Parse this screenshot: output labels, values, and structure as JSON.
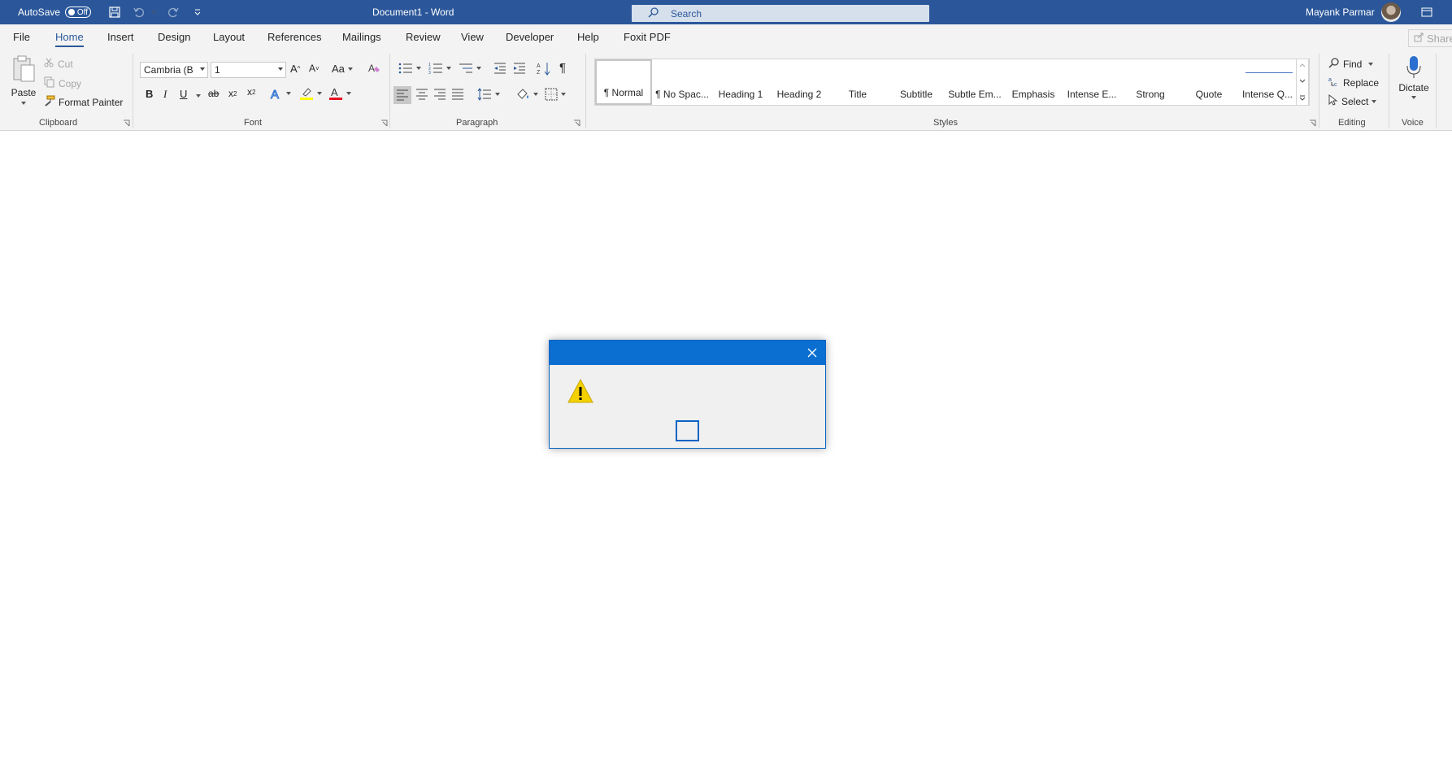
{
  "titlebar": {
    "autosave_label": "AutoSave",
    "autosave_state": "Off",
    "document_title": "Document1  -  Word",
    "search_placeholder": "Search",
    "user_name": "Mayank Parmar"
  },
  "tabs": [
    "File",
    "Home",
    "Insert",
    "Design",
    "Layout",
    "References",
    "Mailings",
    "Review",
    "View",
    "Developer",
    "Help",
    "Foxit PDF"
  ],
  "active_tab": "Home",
  "share_label": "Share",
  "clipboard": {
    "paste": "Paste",
    "cut": "Cut",
    "copy": "Copy",
    "format_painter": "Format Painter",
    "group_label": "Clipboard"
  },
  "font": {
    "font_name": "Cambria (B",
    "font_size": "1",
    "change_case": "Aa",
    "bold": "B",
    "italic": "I",
    "underline": "U",
    "strikethrough": "ab",
    "subscript": "x",
    "superscript": "x",
    "group_label": "Font"
  },
  "paragraph": {
    "show_marks": "¶",
    "group_label": "Paragraph"
  },
  "styles": {
    "items": [
      "¶ Normal",
      "¶ No Spac...",
      "Heading 1",
      "Heading 2",
      "Title",
      "Subtitle",
      "Subtle Em...",
      "Emphasis",
      "Intense E...",
      "Strong",
      "Quote",
      "Intense Q..."
    ],
    "group_label": "Styles"
  },
  "editing": {
    "find": "Find",
    "replace": "Replace",
    "select": "Select",
    "group_label": "Editing"
  },
  "voice": {
    "dictate": "Dictate",
    "group_label": "Voice"
  },
  "colors": {
    "titlebar": "#2b579a",
    "dialog_accent": "#0a6fd0",
    "warning": "#f5d000",
    "font_color": "#e81123",
    "highlight": "#ffff00"
  }
}
